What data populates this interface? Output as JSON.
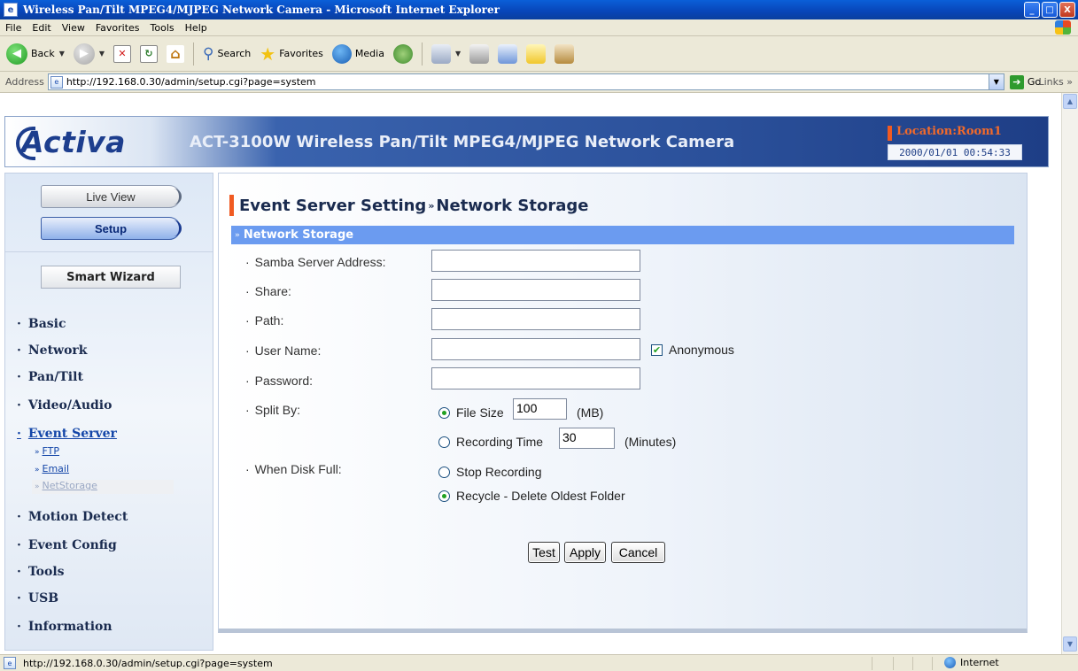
{
  "window": {
    "title": "Wireless Pan/Tilt MPEG4/MJPEG Network Camera - Microsoft Internet Explorer",
    "minimize": "_",
    "maximize": "□",
    "close": "X"
  },
  "menu": [
    "File",
    "Edit",
    "View",
    "Favorites",
    "Tools",
    "Help"
  ],
  "toolbar": {
    "back": "Back",
    "search": "Search",
    "favorites": "Favorites",
    "media": "Media"
  },
  "address": {
    "label": "Address",
    "url": "http://192.168.0.30/admin/setup.cgi?page=system",
    "go": "Go",
    "links": "Links"
  },
  "banner": {
    "logo": "Activa",
    "title": "ACT-3100W Wireless Pan/Tilt MPEG4/MJPEG Network Camera",
    "location": "Location:Room1",
    "datetime": "2000/01/01 00:54:33"
  },
  "sidebar": {
    "live_view": "Live View",
    "setup": "Setup",
    "smart_wizard": "Smart Wizard",
    "nav": [
      "Basic",
      "Network",
      "Pan/Tilt",
      "Video/Audio",
      "Event Server",
      "Motion Detect",
      "Event Config",
      "Tools",
      "USB",
      "Information"
    ],
    "sub": [
      "FTP",
      "Email",
      "NetStorage"
    ]
  },
  "main": {
    "heading_part1": "Event Server Setting",
    "heading_sep": "»",
    "heading_part2": "Network Storage",
    "section": "Network Storage",
    "fields": {
      "samba_label": "Samba Server Address:",
      "samba_value": "",
      "share_label": "Share:",
      "share_value": "",
      "path_label": "Path:",
      "path_value": "",
      "user_label": "User Name:",
      "user_value": "",
      "anonymous": "Anonymous",
      "anonymous_checked": true,
      "password_label": "Password:",
      "password_value": "",
      "split_label": "Split By:",
      "file_size": "File Size",
      "file_size_value": "100",
      "file_size_unit": "(MB)",
      "recording_time": "Recording Time",
      "recording_time_value": "30",
      "recording_time_unit": "(Minutes)",
      "disk_full_label": "When Disk Full:",
      "stop_recording": "Stop Recording",
      "recycle": "Recycle - Delete Oldest Folder"
    },
    "buttons": {
      "test": "Test",
      "apply": "Apply",
      "cancel": "Cancel"
    }
  },
  "status": {
    "text": "http://192.168.0.30/admin/setup.cgi?page=system",
    "zone": "Internet"
  }
}
